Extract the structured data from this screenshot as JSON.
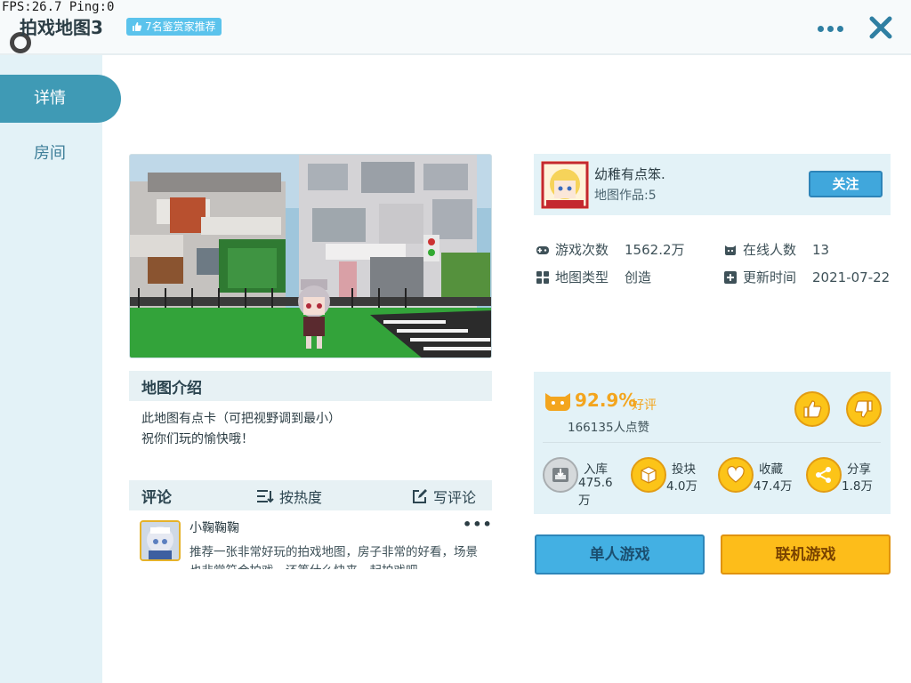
{
  "status": {
    "fps_text": "FPS:26.7  Ping:0"
  },
  "header": {
    "title": "拍戏地图3",
    "badge": "7名鉴赏家推荐",
    "more_icon": "more-dots-icon",
    "close_icon": "close-icon"
  },
  "sidebar": {
    "tabs": [
      {
        "label": "详情",
        "active": true
      },
      {
        "label": "房间",
        "active": false
      }
    ]
  },
  "intro": {
    "title": "地图介绍",
    "text": "此地图有点卡（可把视野调到最小）\n祝你们玩的愉快哦！"
  },
  "comments": {
    "title": "评论",
    "sort_label": "按热度",
    "write_label": "写评论",
    "items": [
      {
        "user": "小鞠鞠鞠",
        "more": "•••",
        "text": "推荐一张非常好玩的拍戏地图，房子非常的好看，场景也非常符合拍戏，还等什么快来一起拍戏吧~"
      }
    ]
  },
  "author": {
    "name": "幼稚有点笨.",
    "works": "地图作品:5",
    "follow_label": "关注"
  },
  "stats": {
    "plays_label": "游戏次数",
    "plays_value": "1562.2万",
    "online_label": "在线人数",
    "online_value": "13",
    "type_label": "地图类型",
    "type_value": "创造",
    "updated_label": "更新时间",
    "updated_value": "2021-07-22"
  },
  "rating": {
    "score": "92.9%",
    "score_label": "好评",
    "count": "166135人点赞",
    "like_icon": "thumbs-up-icon",
    "dislike_icon": "thumbs-down-icon"
  },
  "actions": [
    {
      "label": "入库",
      "value": "475.6万",
      "icon": "download-box-icon"
    },
    {
      "label": "投块",
      "value": "4.0万",
      "icon": "block-icon"
    },
    {
      "label": "收藏",
      "value": "47.4万",
      "icon": "heart-icon"
    },
    {
      "label": "分享",
      "value": "1.8万",
      "icon": "share-icon"
    }
  ],
  "buttons": {
    "single": "单人游戏",
    "multi": "联机游戏"
  },
  "colors": {
    "accent_blue": "#3f9ab5",
    "accent_yellow": "#fcc418",
    "rating_orange": "#f3a51e",
    "panel_bg": "#e3f2f7"
  }
}
